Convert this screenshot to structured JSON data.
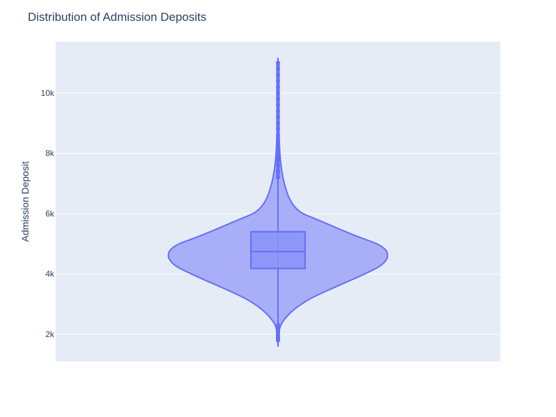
{
  "chart_data": {
    "type": "violin",
    "title": "Distribution of Admission Deposits",
    "xlabel": "",
    "ylabel": "Admission Deposit",
    "ylim": [
      1100,
      11700
    ],
    "yticks": [
      2000,
      4000,
      6000,
      8000,
      10000
    ],
    "ytick_labels": [
      "2k",
      "4k",
      "6k",
      "8k",
      "10k"
    ],
    "grid": true,
    "colors": {
      "plot_bg": "#e5ecf6",
      "grid": "#ffffff",
      "violin_fill": "#a4abf8",
      "violin_line": "#636efa",
      "box_fill": "#8a93f9",
      "text": "#2a3f5f"
    },
    "box": {
      "q1": 4180,
      "median": 4740,
      "q3": 5400,
      "lower_fence": 2350,
      "upper_fence": 7180
    },
    "range": {
      "min": 1600,
      "max": 11150
    },
    "outliers": {
      "low": [
        1800,
        1850,
        1900,
        1950,
        2000,
        2050,
        2100,
        2150,
        2200,
        2250,
        2300
      ],
      "high": [
        7200,
        7400,
        7600,
        7800,
        8000,
        8200,
        8400,
        8600,
        8800,
        9000,
        9200,
        9400,
        9600,
        9800,
        10000,
        10200,
        10400,
        10600,
        10800,
        11000
      ]
    },
    "density": {
      "y": [
        1600,
        2000,
        2300,
        2600,
        2900,
        3200,
        3500,
        3800,
        4100,
        4300,
        4500,
        4650,
        4800,
        5000,
        5200,
        5500,
        5800,
        6000,
        6200,
        6500,
        7000,
        7500,
        8000,
        9000,
        10000,
        11150
      ],
      "width": [
        0,
        0.006,
        0.02,
        0.08,
        0.17,
        0.3,
        0.48,
        0.67,
        0.85,
        0.95,
        0.995,
        1.0,
        0.985,
        0.91,
        0.75,
        0.55,
        0.36,
        0.22,
        0.155,
        0.1,
        0.055,
        0.03,
        0.016,
        0.006,
        0.002,
        0
      ]
    }
  }
}
